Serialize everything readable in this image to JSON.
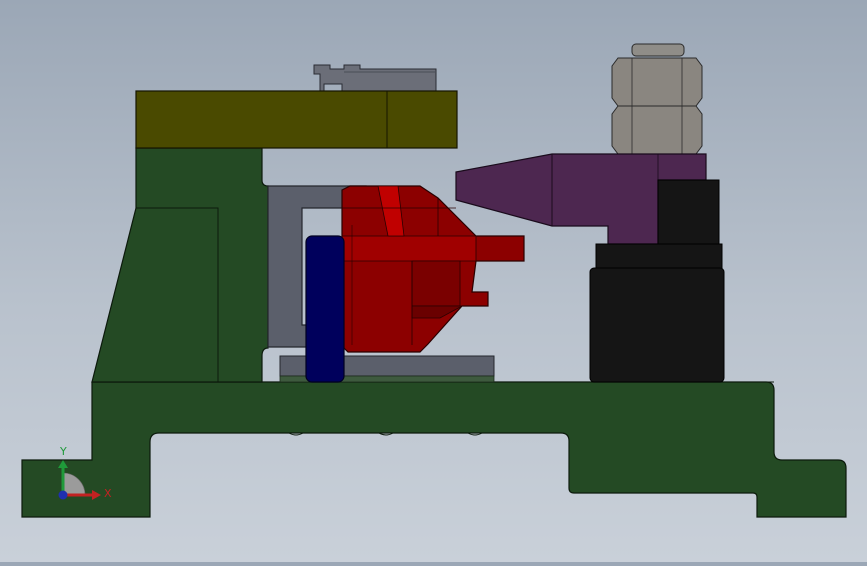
{
  "viewport": {
    "background_top": "#9ba7b6",
    "background_bottom": "#c9d0d9"
  },
  "parts": [
    {
      "name": "base-plate",
      "color": "#244a24"
    },
    {
      "name": "clamp-arm",
      "color": "#4a4a00"
    },
    {
      "name": "locating-pin",
      "color": "#00005c"
    },
    {
      "name": "workpiece",
      "color": "#8c0000"
    },
    {
      "name": "support-bracket",
      "color": "#5b5f6b"
    },
    {
      "name": "pressure-pad",
      "color": "#4d2750"
    },
    {
      "name": "cylinder-body",
      "color": "#151515"
    },
    {
      "name": "hex-nut",
      "color": "#8a8680"
    },
    {
      "name": "clamp-screw",
      "color": "#6b6e78"
    }
  ],
  "triad": {
    "x_label": "X",
    "y_label": "Y",
    "x_color": "#c22222",
    "y_color": "#1f9a3a",
    "z_color": "#1f2fb0"
  }
}
